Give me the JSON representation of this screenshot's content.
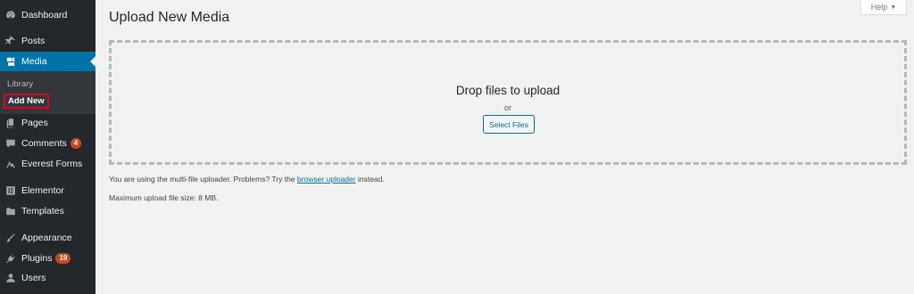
{
  "sidebar": {
    "items": [
      {
        "id": "dashboard",
        "label": "Dashboard",
        "icon": "dashboard-icon"
      },
      {
        "id": "posts",
        "label": "Posts",
        "icon": "pin-icon"
      },
      {
        "id": "media",
        "label": "Media",
        "icon": "media-icon",
        "active": true
      },
      {
        "id": "pages",
        "label": "Pages",
        "icon": "pages-icon"
      },
      {
        "id": "comments",
        "label": "Comments",
        "icon": "comment-icon",
        "badge": "4"
      },
      {
        "id": "everest-forms",
        "label": "Everest Forms",
        "icon": "everest-forms-icon"
      },
      {
        "id": "elementor",
        "label": "Elementor",
        "icon": "elementor-icon"
      },
      {
        "id": "templates",
        "label": "Templates",
        "icon": "folder-icon"
      },
      {
        "id": "appearance",
        "label": "Appearance",
        "icon": "paintbrush-icon"
      },
      {
        "id": "plugins",
        "label": "Plugins",
        "icon": "plug-icon",
        "badge": "19"
      },
      {
        "id": "users",
        "label": "Users",
        "icon": "user-icon"
      }
    ],
    "submenu": {
      "library": "Library",
      "add_new": "Add New"
    }
  },
  "header": {
    "title": "Upload New Media",
    "help": "Help",
    "help_arrow": "▼"
  },
  "uploader": {
    "drop_text": "Drop files to upload",
    "or_text": "or",
    "select_button": "Select Files"
  },
  "info": {
    "uploader_prefix": "You are using the multi-file uploader. Problems? Try the",
    "uploader_link": "browser uploader",
    "uploader_suffix": "instead.",
    "max_size": "Maximum upload file size: 8 MB."
  },
  "colors": {
    "sidebar_bg": "#23282d",
    "active_bg": "#0073aa",
    "badge_bg": "#ca4a1f",
    "highlight_border": "#e3001b"
  }
}
